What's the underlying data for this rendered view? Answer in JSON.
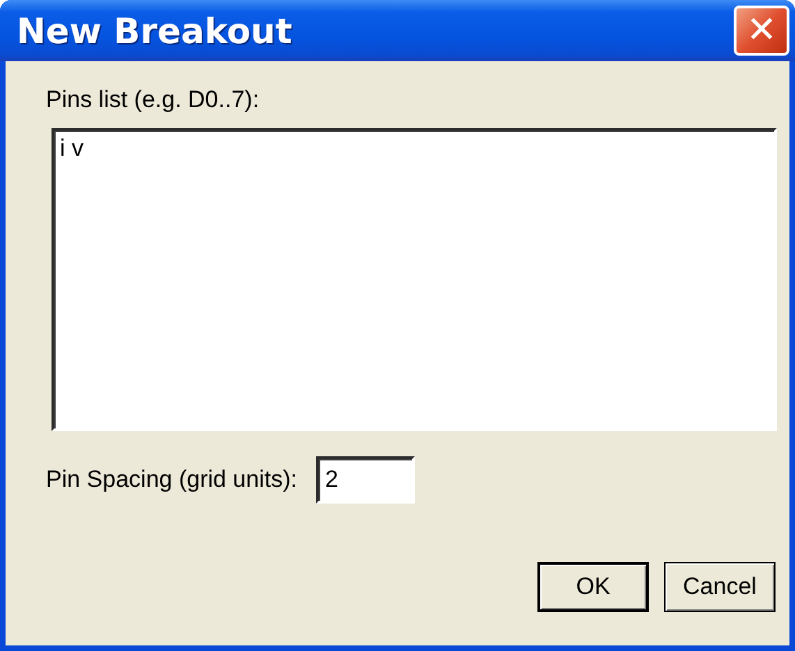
{
  "window": {
    "title": "New Breakout",
    "close_label": "✕"
  },
  "pins_list": {
    "label": "Pins list (e.g. D0..7):",
    "value": "i v"
  },
  "pin_spacing": {
    "label": "Pin Spacing (grid units):",
    "value": "2"
  },
  "buttons": [
    {
      "label": "OK",
      "default": true
    },
    {
      "label": "Cancel",
      "default": false
    }
  ]
}
